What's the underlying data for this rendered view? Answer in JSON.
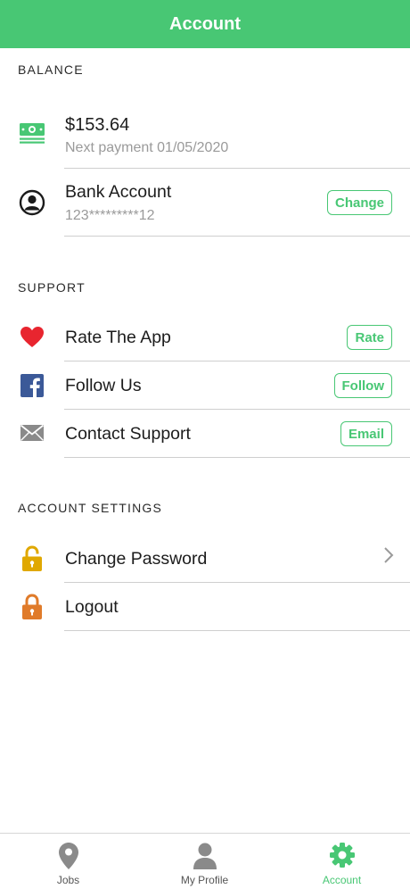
{
  "header": {
    "title": "Account"
  },
  "balance": {
    "section_title": "BALANCE",
    "amount": "$153.64",
    "next_payment": "Next payment 01/05/2020",
    "bank_label": "Bank Account",
    "bank_number": "123*********12",
    "change_label": "Change"
  },
  "support": {
    "section_title": "SUPPORT",
    "items": [
      {
        "label": "Rate The App",
        "button": "Rate",
        "icon": "heart-icon"
      },
      {
        "label": "Follow Us",
        "button": "Follow",
        "icon": "facebook-icon"
      },
      {
        "label": "Contact Support",
        "button": "Email",
        "icon": "mail-icon"
      }
    ]
  },
  "account_settings": {
    "section_title": "ACCOUNT SETTINGS",
    "items": [
      {
        "label": "Change Password",
        "icon": "unlock-icon"
      },
      {
        "label": "Logout",
        "icon": "lock-icon"
      }
    ]
  },
  "bottom_nav": {
    "items": [
      {
        "label": "Jobs",
        "icon": "map-pin-icon"
      },
      {
        "label": "My Profile",
        "icon": "person-icon"
      },
      {
        "label": "Account",
        "icon": "gear-icon",
        "active": true
      }
    ]
  },
  "colors": {
    "accent": "#48c774",
    "heart": "#e8252f",
    "facebook": "#3b5998",
    "unlock": "#e0a800",
    "lock": "#e07b2a"
  }
}
